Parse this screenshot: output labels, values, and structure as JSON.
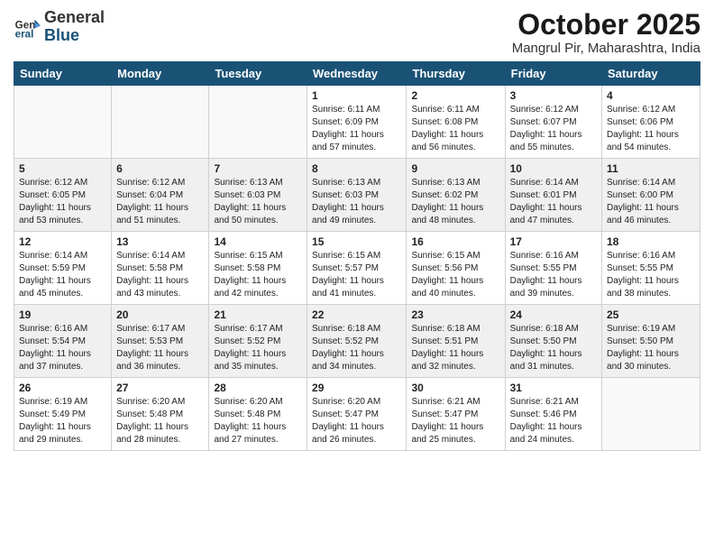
{
  "header": {
    "logo_general": "General",
    "logo_blue": "Blue",
    "title": "October 2025",
    "location": "Mangrul Pir, Maharashtra, India"
  },
  "weekdays": [
    "Sunday",
    "Monday",
    "Tuesday",
    "Wednesday",
    "Thursday",
    "Friday",
    "Saturday"
  ],
  "weeks": [
    [
      {
        "day": "",
        "info": ""
      },
      {
        "day": "",
        "info": ""
      },
      {
        "day": "",
        "info": ""
      },
      {
        "day": "1",
        "info": "Sunrise: 6:11 AM\nSunset: 6:09 PM\nDaylight: 11 hours\nand 57 minutes."
      },
      {
        "day": "2",
        "info": "Sunrise: 6:11 AM\nSunset: 6:08 PM\nDaylight: 11 hours\nand 56 minutes."
      },
      {
        "day": "3",
        "info": "Sunrise: 6:12 AM\nSunset: 6:07 PM\nDaylight: 11 hours\nand 55 minutes."
      },
      {
        "day": "4",
        "info": "Sunrise: 6:12 AM\nSunset: 6:06 PM\nDaylight: 11 hours\nand 54 minutes."
      }
    ],
    [
      {
        "day": "5",
        "info": "Sunrise: 6:12 AM\nSunset: 6:05 PM\nDaylight: 11 hours\nand 53 minutes."
      },
      {
        "day": "6",
        "info": "Sunrise: 6:12 AM\nSunset: 6:04 PM\nDaylight: 11 hours\nand 51 minutes."
      },
      {
        "day": "7",
        "info": "Sunrise: 6:13 AM\nSunset: 6:03 PM\nDaylight: 11 hours\nand 50 minutes."
      },
      {
        "day": "8",
        "info": "Sunrise: 6:13 AM\nSunset: 6:03 PM\nDaylight: 11 hours\nand 49 minutes."
      },
      {
        "day": "9",
        "info": "Sunrise: 6:13 AM\nSunset: 6:02 PM\nDaylight: 11 hours\nand 48 minutes."
      },
      {
        "day": "10",
        "info": "Sunrise: 6:14 AM\nSunset: 6:01 PM\nDaylight: 11 hours\nand 47 minutes."
      },
      {
        "day": "11",
        "info": "Sunrise: 6:14 AM\nSunset: 6:00 PM\nDaylight: 11 hours\nand 46 minutes."
      }
    ],
    [
      {
        "day": "12",
        "info": "Sunrise: 6:14 AM\nSunset: 5:59 PM\nDaylight: 11 hours\nand 45 minutes."
      },
      {
        "day": "13",
        "info": "Sunrise: 6:14 AM\nSunset: 5:58 PM\nDaylight: 11 hours\nand 43 minutes."
      },
      {
        "day": "14",
        "info": "Sunrise: 6:15 AM\nSunset: 5:58 PM\nDaylight: 11 hours\nand 42 minutes."
      },
      {
        "day": "15",
        "info": "Sunrise: 6:15 AM\nSunset: 5:57 PM\nDaylight: 11 hours\nand 41 minutes."
      },
      {
        "day": "16",
        "info": "Sunrise: 6:15 AM\nSunset: 5:56 PM\nDaylight: 11 hours\nand 40 minutes."
      },
      {
        "day": "17",
        "info": "Sunrise: 6:16 AM\nSunset: 5:55 PM\nDaylight: 11 hours\nand 39 minutes."
      },
      {
        "day": "18",
        "info": "Sunrise: 6:16 AM\nSunset: 5:55 PM\nDaylight: 11 hours\nand 38 minutes."
      }
    ],
    [
      {
        "day": "19",
        "info": "Sunrise: 6:16 AM\nSunset: 5:54 PM\nDaylight: 11 hours\nand 37 minutes."
      },
      {
        "day": "20",
        "info": "Sunrise: 6:17 AM\nSunset: 5:53 PM\nDaylight: 11 hours\nand 36 minutes."
      },
      {
        "day": "21",
        "info": "Sunrise: 6:17 AM\nSunset: 5:52 PM\nDaylight: 11 hours\nand 35 minutes."
      },
      {
        "day": "22",
        "info": "Sunrise: 6:18 AM\nSunset: 5:52 PM\nDaylight: 11 hours\nand 34 minutes."
      },
      {
        "day": "23",
        "info": "Sunrise: 6:18 AM\nSunset: 5:51 PM\nDaylight: 11 hours\nand 32 minutes."
      },
      {
        "day": "24",
        "info": "Sunrise: 6:18 AM\nSunset: 5:50 PM\nDaylight: 11 hours\nand 31 minutes."
      },
      {
        "day": "25",
        "info": "Sunrise: 6:19 AM\nSunset: 5:50 PM\nDaylight: 11 hours\nand 30 minutes."
      }
    ],
    [
      {
        "day": "26",
        "info": "Sunrise: 6:19 AM\nSunset: 5:49 PM\nDaylight: 11 hours\nand 29 minutes."
      },
      {
        "day": "27",
        "info": "Sunrise: 6:20 AM\nSunset: 5:48 PM\nDaylight: 11 hours\nand 28 minutes."
      },
      {
        "day": "28",
        "info": "Sunrise: 6:20 AM\nSunset: 5:48 PM\nDaylight: 11 hours\nand 27 minutes."
      },
      {
        "day": "29",
        "info": "Sunrise: 6:20 AM\nSunset: 5:47 PM\nDaylight: 11 hours\nand 26 minutes."
      },
      {
        "day": "30",
        "info": "Sunrise: 6:21 AM\nSunset: 5:47 PM\nDaylight: 11 hours\nand 25 minutes."
      },
      {
        "day": "31",
        "info": "Sunrise: 6:21 AM\nSunset: 5:46 PM\nDaylight: 11 hours\nand 24 minutes."
      },
      {
        "day": "",
        "info": ""
      }
    ]
  ]
}
